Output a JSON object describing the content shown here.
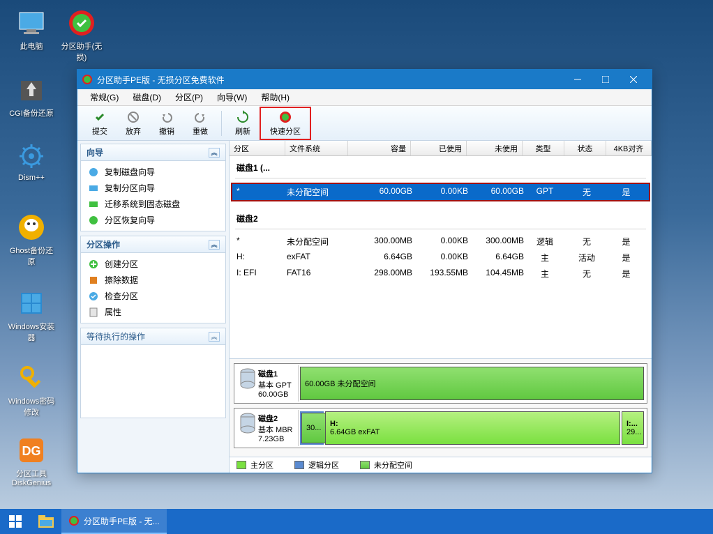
{
  "desktop": {
    "icons": [
      {
        "label": "此电脑"
      },
      {
        "label": "分区助手(无损)"
      },
      {
        "label": "CGI备份还原"
      },
      {
        "label": "Dism++"
      },
      {
        "label": "Ghost备份还原"
      },
      {
        "label": "Windows安装器"
      },
      {
        "label": "Windows密码修改"
      },
      {
        "label": "分区工具DiskGenius"
      }
    ]
  },
  "window": {
    "title": "分区助手PE版 - 无损分区免费软件"
  },
  "menu": [
    "常规(G)",
    "磁盘(D)",
    "分区(P)",
    "向导(W)",
    "帮助(H)"
  ],
  "toolbar": [
    {
      "label": "提交"
    },
    {
      "label": "放弃"
    },
    {
      "label": "撤销"
    },
    {
      "label": "重做"
    },
    {
      "label": "刷新"
    },
    {
      "label": "快速分区"
    }
  ],
  "leftPanel": {
    "wizard": {
      "title": "向导",
      "items": [
        "复制磁盘向导",
        "复制分区向导",
        "迁移系统到固态磁盘",
        "分区恢复向导"
      ]
    },
    "ops": {
      "title": "分区操作",
      "items": [
        "创建分区",
        "擦除数据",
        "检查分区",
        "属性"
      ]
    },
    "pending": {
      "title": "等待执行的操作"
    }
  },
  "table": {
    "headers": [
      "分区",
      "文件系统",
      "容量",
      "已使用",
      "未使用",
      "类型",
      "状态",
      "4KB对齐"
    ],
    "widths": [
      80,
      90,
      90,
      80,
      80,
      60,
      60,
      60
    ],
    "disk1": {
      "title": "磁盘1 (...",
      "rows": [
        {
          "partition": "*",
          "fs": "未分配空间",
          "cap": "60.00GB",
          "used": "0.00KB",
          "free": "60.00GB",
          "type": "GPT",
          "status": "无",
          "align": "是",
          "selected": true
        }
      ]
    },
    "disk2": {
      "title": "磁盘2",
      "rows": [
        {
          "partition": "*",
          "fs": "未分配空间",
          "cap": "300.00MB",
          "used": "0.00KB",
          "free": "300.00MB",
          "type": "逻辑",
          "status": "无",
          "align": "是"
        },
        {
          "partition": "H:",
          "fs": "exFAT",
          "cap": "6.64GB",
          "used": "0.00KB",
          "free": "6.64GB",
          "type": "主",
          "status": "活动",
          "align": "是"
        },
        {
          "partition": "I: EFI",
          "fs": "FAT16",
          "cap": "298.00MB",
          "used": "193.55MB",
          "free": "104.45MB",
          "type": "主",
          "status": "无",
          "align": "是"
        }
      ]
    }
  },
  "diskMap": {
    "d1": {
      "name": "磁盘1",
      "type": "基本 GPT",
      "size": "60.00GB",
      "block": "60.00GB 未分配空间"
    },
    "d2": {
      "name": "磁盘2",
      "type": "基本 MBR",
      "size": "7.23GB",
      "b1": "30...",
      "b2a": "H:",
      "b2b": "6.64GB exFAT",
      "b3a": "I:...",
      "b3b": "29..."
    }
  },
  "legend": {
    "primary": "主分区",
    "logical": "逻辑分区",
    "unalloc": "未分配空间"
  },
  "taskbar": {
    "app": "分区助手PE版 - 无..."
  }
}
